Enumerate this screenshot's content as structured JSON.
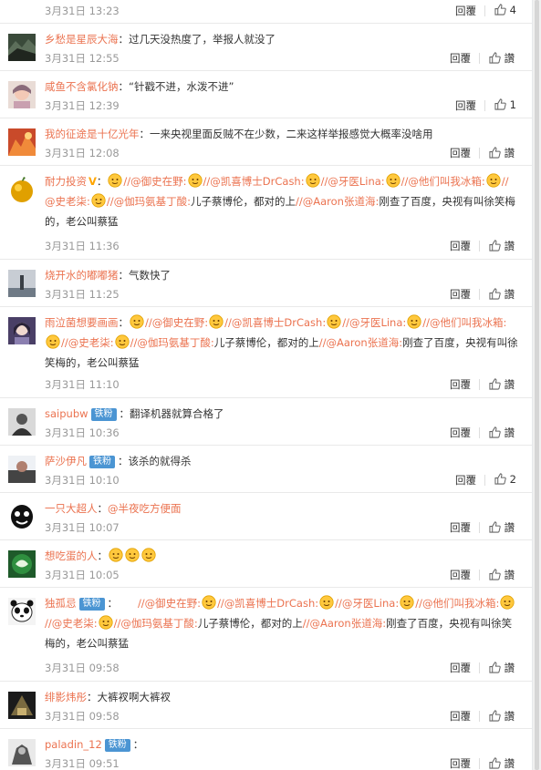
{
  "labels": {
    "reply": "回覆",
    "like": "讚"
  },
  "partial_top": {
    "time": "3月31日 13:23",
    "likes": "4"
  },
  "comments": [
    {
      "user": "乡愁是星辰大海",
      "text": "过几天没热度了，举报人就没了",
      "time": "3月31日 12:55",
      "likes": "讚"
    },
    {
      "user": "咸鱼不含氯化钠",
      "text": "“针戳不进，水泼不进”",
      "time": "3月31日 12:39",
      "likes": "1"
    },
    {
      "user": "我的征途是十亿光年",
      "text": "一来央视里面反贼不在少数，二来这样举报感觉大概率没啥用",
      "time": "3月31日 12:08",
      "likes": "讚"
    },
    {
      "user": "耐力投资",
      "time": "3月31日 11:36",
      "likes": "讚",
      "m1": "//@御史在野:",
      "m2": "//@凯喜博士DrCash:",
      "m3": "//@牙医Lina:",
      "m4": "//@他们叫我冰箱:",
      "m5": "//@史老柒:",
      "m6": "//@伽玛氨基丁酸:",
      "t1": "儿子蔡博伦，都对的上",
      "m7": "//@Aaron张道海:",
      "t2": "刚查了百度，央视有叫徐笑梅的，老公叫蔡猛"
    },
    {
      "user": "烧开水的嘟嘟猪",
      "text": "气数快了",
      "time": "3月31日 11:25",
      "likes": "讚"
    },
    {
      "user": "雨泣菌想要画画",
      "time": "3月31日 11:10",
      "likes": "讚",
      "m1": "//@御史在野:",
      "m2": "//@凯喜博士DrCash:",
      "m3": "//@牙医Lina:",
      "m4": "//@他们叫我冰箱:",
      "m5": "//@史老柒:",
      "m6": "//@伽玛氨基丁酸:",
      "t1": "儿子蔡博伦，都对的上",
      "m7": "//@Aaron张道海:",
      "t2": "刚查了百度，央视有叫徐笑梅的，老公叫蔡猛"
    },
    {
      "user": "saipubw",
      "badge": "铁粉",
      "text": "翻译机器就算合格了",
      "time": "3月31日 10:36",
      "likes": "讚"
    },
    {
      "user": "萨沙伊凡",
      "badge": "铁粉",
      "text": "该杀的就得杀",
      "time": "3月31日 10:10",
      "likes": "2"
    },
    {
      "user": "一只大超人",
      "mention": "@半夜吃方便面",
      "time": "3月31日 10:07",
      "likes": "讚"
    },
    {
      "user": "想吃蛋的人",
      "time": "3月31日 10:05",
      "likes": "讚"
    },
    {
      "user": "独孤忌",
      "badge": "铁粉",
      "time": "3月31日 09:58",
      "likes": "讚",
      "m1": "//@御史在野:",
      "m2": "//@凯喜博士DrCash:",
      "m3": "//@牙医Lina:",
      "m4": "//@他们叫我冰箱:",
      "m5": "//@史老柒:",
      "m6": "//@伽玛氨基丁酸:",
      "t1": "儿子蔡博伦，都对的上",
      "m7": "//@Aaron张道海:",
      "t2": "刚查了百度，央视有叫徐笑梅的，老公叫蔡猛"
    },
    {
      "user": "绯影炜彤",
      "text": "大裤衩啊大裤衩",
      "time": "3月31日 09:58",
      "likes": "讚"
    },
    {
      "user": "paladin_12",
      "badge": "铁粉",
      "time": "3月31日 09:51",
      "likes": "讚"
    }
  ]
}
